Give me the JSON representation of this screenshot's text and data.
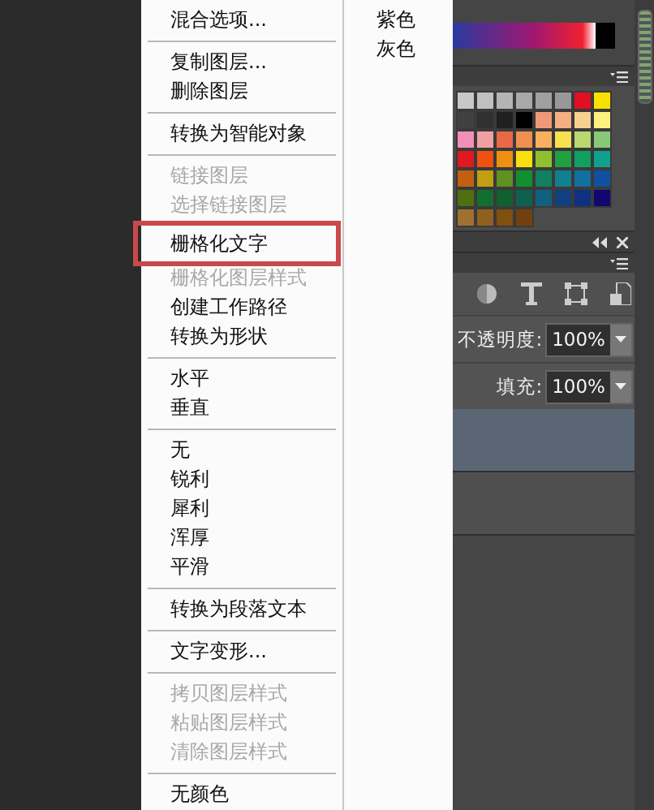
{
  "context_menu": {
    "groups": [
      [
        {
          "label": "混合选项...",
          "disabled": false,
          "highlighted": false
        }
      ],
      [
        {
          "label": "复制图层...",
          "disabled": false,
          "highlighted": false
        },
        {
          "label": "删除图层",
          "disabled": false,
          "highlighted": false
        }
      ],
      [
        {
          "label": "转换为智能对象",
          "disabled": false,
          "highlighted": false
        }
      ],
      [
        {
          "label": "链接图层",
          "disabled": true,
          "highlighted": false
        },
        {
          "label": "选择链接图层",
          "disabled": true,
          "highlighted": false
        },
        {
          "label": "栅格化文字",
          "disabled": false,
          "highlighted": true
        },
        {
          "label": "栅格化图层样式",
          "disabled": true,
          "highlighted": false
        },
        {
          "label": "创建工作路径",
          "disabled": false,
          "highlighted": false
        },
        {
          "label": "转换为形状",
          "disabled": false,
          "highlighted": false
        }
      ],
      [
        {
          "label": "水平",
          "disabled": false,
          "highlighted": false
        },
        {
          "label": "垂直",
          "disabled": false,
          "highlighted": false
        }
      ],
      [
        {
          "label": "无",
          "disabled": false,
          "highlighted": false
        },
        {
          "label": "锐利",
          "disabled": false,
          "highlighted": false
        },
        {
          "label": "犀利",
          "disabled": false,
          "highlighted": false
        },
        {
          "label": "浑厚",
          "disabled": false,
          "highlighted": false
        },
        {
          "label": "平滑",
          "disabled": false,
          "highlighted": false
        }
      ],
      [
        {
          "label": "转换为段落文本",
          "disabled": false,
          "highlighted": false
        }
      ],
      [
        {
          "label": "文字变形...",
          "disabled": false,
          "highlighted": false
        }
      ],
      [
        {
          "label": "拷贝图层样式",
          "disabled": true,
          "highlighted": false
        },
        {
          "label": "粘贴图层样式",
          "disabled": true,
          "highlighted": false
        },
        {
          "label": "清除图层样式",
          "disabled": true,
          "highlighted": false
        }
      ],
      [
        {
          "label": "无颜色",
          "disabled": false,
          "highlighted": false
        }
      ]
    ],
    "color_column": [
      "紫色",
      "灰色"
    ]
  },
  "swatches": [
    {
      "color": "#c8c8c8"
    },
    {
      "color": "#c0c0c0"
    },
    {
      "color": "#b4b4b4"
    },
    {
      "color": "#a8a8a8"
    },
    {
      "color": "#a0a0a0"
    },
    {
      "color": "#989898"
    },
    {
      "color": "#e01020"
    },
    {
      "color": "#f8e000"
    },
    {
      "color": "#404040"
    },
    {
      "color": "#303030"
    },
    {
      "color": "#202020"
    },
    {
      "color": "#000000"
    },
    {
      "color": "#f09878"
    },
    {
      "color": "#f4b080"
    },
    {
      "color": "#f8d090"
    },
    {
      "color": "#fff080"
    },
    {
      "color": "#f090b8"
    },
    {
      "color": "#f0a0a0"
    },
    {
      "color": "#e86848"
    },
    {
      "color": "#f09050"
    },
    {
      "color": "#f8b060"
    },
    {
      "color": "#f8e050"
    },
    {
      "color": "#b8d870"
    },
    {
      "color": "#88c878"
    },
    {
      "color": "#e01820"
    },
    {
      "color": "#f05010"
    },
    {
      "color": "#f09010"
    },
    {
      "color": "#f8e010"
    },
    {
      "color": "#90c030"
    },
    {
      "color": "#20a040"
    },
    {
      "color": "#10a060"
    },
    {
      "color": "#10a090"
    },
    {
      "color": "#c06010"
    },
    {
      "color": "#c0a010"
    },
    {
      "color": "#609020"
    },
    {
      "color": "#109030"
    },
    {
      "color": "#108060"
    },
    {
      "color": "#108090"
    },
    {
      "color": "#1070a0"
    },
    {
      "color": "#1050a0"
    },
    {
      "color": "#507010"
    },
    {
      "color": "#107030"
    },
    {
      "color": "#106030"
    },
    {
      "color": "#106050"
    },
    {
      "color": "#106080"
    },
    {
      "color": "#104080"
    },
    {
      "color": "#103080"
    },
    {
      "color": "#100870"
    },
    {
      "color": "#a07030"
    },
    {
      "color": "#906020"
    },
    {
      "color": "#805010"
    },
    {
      "color": "#704010"
    }
  ],
  "layers_panel": {
    "opacity": {
      "label": "不透明度:",
      "value": "100%"
    },
    "fill": {
      "label": "填充:",
      "value": "100%"
    },
    "rows": [
      {
        "selected": true
      },
      {
        "selected": false
      }
    ]
  }
}
